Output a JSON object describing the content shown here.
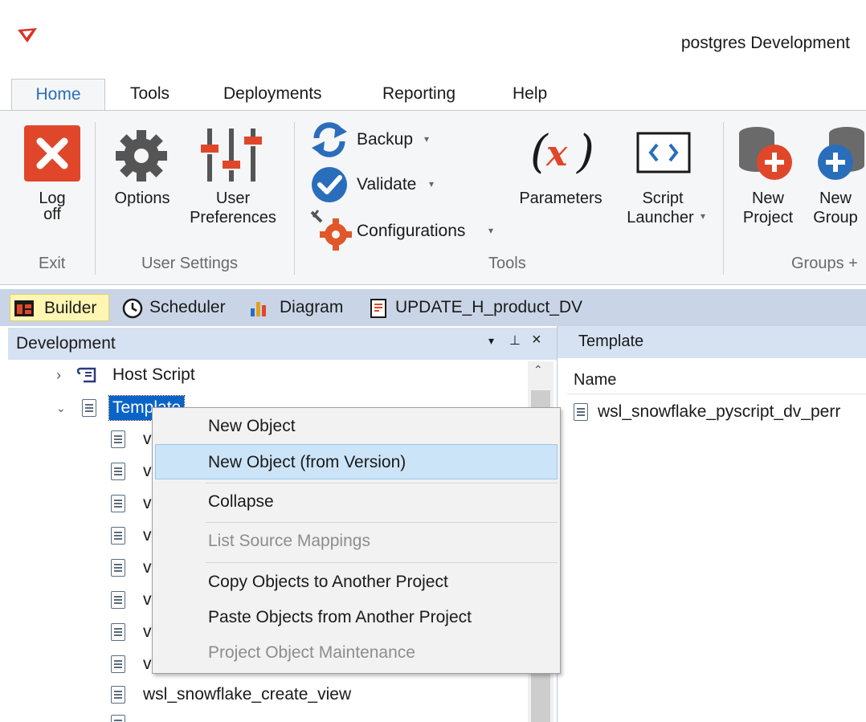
{
  "window": {
    "title": "postgres Development"
  },
  "ribbon_tabs": [
    {
      "label": "Home",
      "active": true
    },
    {
      "label": "Tools"
    },
    {
      "label": "Deployments"
    },
    {
      "label": "Reporting"
    },
    {
      "label": "Help"
    }
  ],
  "ribbon": {
    "log_off": {
      "line1": "Log",
      "line2": "off"
    },
    "options": "Options",
    "user_preferences": {
      "line1": "User",
      "line2": "Preferences"
    },
    "backup": "Backup",
    "validate": "Validate",
    "configurations": "Configurations",
    "parameters": "Parameters",
    "script_launcher": {
      "line1": "Script",
      "line2": "Launcher"
    },
    "new_project": {
      "line1": "New",
      "line2": "Project"
    },
    "new_group": {
      "line1": "New",
      "line2": "Group"
    },
    "groups": {
      "exit": "Exit",
      "user_settings": "User Settings",
      "tools": "Tools",
      "groups": "Groups +"
    }
  },
  "doc_tabs": [
    "Builder",
    "Scheduler",
    "Diagram",
    "UPDATE_H_product_DV"
  ],
  "left_pane": {
    "title": "Development",
    "tree": {
      "host_script": "Host Script",
      "template": "Template",
      "truncated_prefix": "v",
      "create_view": "wsl_snowflake_create_view"
    }
  },
  "right_pane": {
    "title": "Template",
    "column": "Name",
    "rows": [
      "wsl_snowflake_pyscript_dv_perr"
    ]
  },
  "context_menu": {
    "items": [
      {
        "label": "New Object",
        "disabled": false
      },
      {
        "label": "New Object (from Version)",
        "disabled": false,
        "highlighted": true
      },
      {
        "label": "Collapse",
        "disabled": false
      },
      {
        "label": "List Source Mappings",
        "disabled": true
      },
      {
        "label": "Copy Objects to Another Project",
        "disabled": false
      },
      {
        "label": "Paste Objects from Another Project",
        "disabled": false
      },
      {
        "label": "Project Object Maintenance",
        "disabled": true
      }
    ]
  },
  "colors": {
    "accent": "#2a6ebb",
    "close_red": "#e0472a",
    "doc_strip": "#c9d5e6",
    "highlight": "#cce4f7"
  }
}
